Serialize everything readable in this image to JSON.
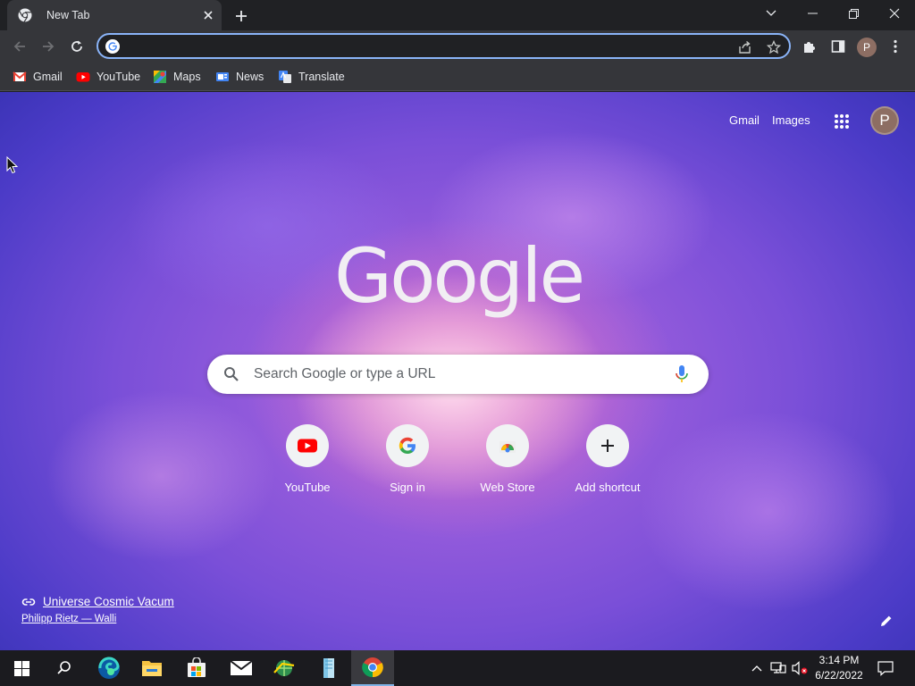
{
  "tab": {
    "title": "New Tab",
    "favicon": "chrome-icon"
  },
  "omnibox": {
    "value": "",
    "placeholder": ""
  },
  "profile_initial": "P",
  "bookmarks": [
    {
      "label": "Gmail",
      "icon": "gmail-icon"
    },
    {
      "label": "YouTube",
      "icon": "youtube-icon"
    },
    {
      "label": "Maps",
      "icon": "maps-icon"
    },
    {
      "label": "News",
      "icon": "news-icon"
    },
    {
      "label": "Translate",
      "icon": "translate-icon"
    }
  ],
  "ntp": {
    "header_links": {
      "gmail": "Gmail",
      "images": "Images"
    },
    "logo_text": "Google",
    "search": {
      "placeholder": "Search Google or type a URL"
    },
    "shortcuts": [
      {
        "label": "YouTube",
        "icon": "youtube-icon"
      },
      {
        "label": "Sign in",
        "icon": "google-icon"
      },
      {
        "label": "Web Store",
        "icon": "web-store-icon"
      },
      {
        "label": "Add shortcut",
        "icon": "plus-icon"
      }
    ],
    "attribution": {
      "title": "Universe Cosmic Vacum",
      "author": "Philipp Rietz — Walli"
    }
  },
  "taskbar": {
    "apps": [
      "start-icon",
      "search-icon",
      "edge-icon",
      "file-explorer-icon",
      "microsoft-store-icon",
      "mail-icon",
      "network-app-icon",
      "notepad-icon",
      "chrome-icon"
    ],
    "clock": {
      "time": "3:14 PM",
      "date": "6/22/2022"
    }
  },
  "colors": {
    "accent": "#8ab4f8",
    "tab_bg": "#35363a",
    "frame": "#202124"
  }
}
